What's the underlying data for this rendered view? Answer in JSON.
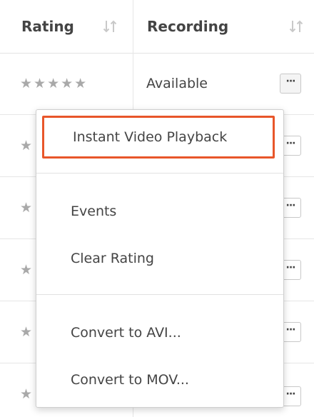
{
  "table": {
    "headers": {
      "rating": "Rating",
      "recording": "Recording"
    },
    "rows": [
      {
        "stars": "★★★★★",
        "recording": "Available"
      },
      {
        "stars": "★",
        "recording": ""
      },
      {
        "stars": "★",
        "recording": ""
      },
      {
        "stars": "★",
        "recording": ""
      },
      {
        "stars": "★",
        "recording": ""
      },
      {
        "stars": "★",
        "recording": ""
      }
    ],
    "more_button_label": "···"
  },
  "menu": {
    "items": [
      {
        "label": "Instant Video Playback",
        "highlighted": true
      },
      {
        "label": "Events"
      },
      {
        "label": "Clear Rating"
      },
      {
        "label": "Convert to AVI..."
      },
      {
        "label": "Convert to MOV..."
      }
    ]
  },
  "colors": {
    "highlight_border": "#e8562a",
    "star": "#a9a9a9"
  },
  "icons": {
    "sort": "sort-icon",
    "more": "more-options-icon"
  }
}
